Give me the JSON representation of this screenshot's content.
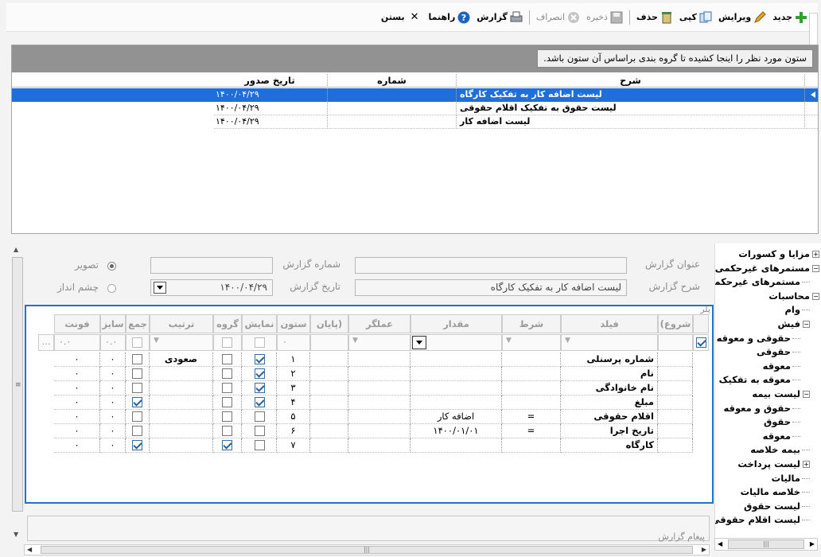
{
  "toolbar": {
    "items": [
      {
        "label": "جدید",
        "icon": "add-icon",
        "enabled": true
      },
      {
        "label": "ویرایش",
        "icon": "pencil-icon",
        "enabled": true
      },
      {
        "label": "کپی",
        "icon": "copy-icon",
        "enabled": true
      },
      {
        "label": "حذف",
        "icon": "delete-icon",
        "enabled": true
      },
      {
        "label": "ذخیره",
        "icon": "save-icon",
        "enabled": false
      },
      {
        "label": "انصراف",
        "icon": "cancel-icon",
        "enabled": false
      },
      {
        "label": "گزارش",
        "icon": "print-icon",
        "enabled": true
      },
      {
        "label": "راهنما",
        "icon": "help-icon",
        "enabled": true
      },
      {
        "label": "بستن",
        "icon": "close-icon",
        "enabled": true
      }
    ]
  },
  "report_grid": {
    "group_hint": "ستون مورد نظر را اینجا کشیده تا گروه بندی براساس آن ستون باشد.",
    "headers": {
      "desc": "شرح",
      "number": "شماره",
      "date": "تاریخ صدور"
    },
    "rows": [
      {
        "desc": "لیست اضافه کار به تفکیک کارگاه",
        "number": "",
        "date": "۱۴۰۰/۰۴/۲۹",
        "selected": true
      },
      {
        "desc": "لیست حقوق به تفکیک اقلام حقوقی",
        "number": "",
        "date": "۱۴۰۰/۰۴/۲۹",
        "selected": false
      },
      {
        "desc": "لیست اضافه کار",
        "number": "",
        "date": "۱۴۰۰/۰۴/۲۹",
        "selected": false
      }
    ]
  },
  "form": {
    "title_label": "عنوان گزارش",
    "title_value": "",
    "desc_label": "شرح گزارش",
    "desc_value": "لیست اضافه کار به تفکیک کارگاه",
    "number_label": "شماره گزارش",
    "number_value": "",
    "date_label": "تاریخ گزارش",
    "date_value": "۱۴۰۰/۰۴/۲۹",
    "opt_image": "تصویر",
    "opt_landscape": "چشم انداز",
    "msg_label": "پیغام گزارش"
  },
  "detail": {
    "side_label": "پلر",
    "headers": {
      "start": "(شروع",
      "field": "فیلد",
      "cond": "شرط",
      "value": "مقدار",
      "op": "عملگر",
      "end": "پایان)",
      "col": "ستون",
      "show": "نمایش",
      "group": "گروه",
      "order": "ترتیب",
      "sum": "جمع",
      "size": "سایز",
      "font": "فونت"
    },
    "filters": {
      "col": "۰",
      "size": "۰.۰",
      "font": "۰.۰"
    },
    "rows": [
      {
        "field": "شماره پرسنلی",
        "cond": "",
        "value": "",
        "col": "۱",
        "show": true,
        "group": false,
        "order": "صعودی",
        "sum": false,
        "size": "۰",
        "font": "۰"
      },
      {
        "field": "نام",
        "cond": "",
        "value": "",
        "col": "۲",
        "show": true,
        "group": false,
        "order": "",
        "sum": false,
        "size": "۰",
        "font": "۰"
      },
      {
        "field": "نام خانوادگی",
        "cond": "",
        "value": "",
        "col": "۳",
        "show": true,
        "group": false,
        "order": "",
        "sum": false,
        "size": "۰",
        "font": "۰"
      },
      {
        "field": "مبلغ",
        "cond": "",
        "value": "",
        "col": "۴",
        "show": true,
        "group": false,
        "order": "",
        "sum": true,
        "size": "۰",
        "font": "۰"
      },
      {
        "field": "اقلام حقوقی",
        "cond": "=",
        "value": "اضافه کار",
        "col": "۵",
        "show": false,
        "group": false,
        "order": "",
        "sum": false,
        "size": "۰",
        "font": "۰"
      },
      {
        "field": "تاریخ اجرا",
        "cond": "=",
        "value": "۱۴۰۰/۰۱/۰۱",
        "col": "۶",
        "show": false,
        "group": false,
        "order": "",
        "sum": false,
        "size": "۰",
        "font": "۰"
      },
      {
        "field": "کارگاه",
        "cond": "",
        "value": "",
        "col": "۷",
        "show": false,
        "group": true,
        "order": "",
        "sum": true,
        "size": "۰",
        "font": "۰"
      }
    ]
  },
  "tree": {
    "items": [
      {
        "label": "مزایا و کسورات",
        "level": 0,
        "toggle": "+"
      },
      {
        "label": "مستمرهای غیرحکمی",
        "level": 0,
        "toggle": "-"
      },
      {
        "label": "مستمرهای غیرحکمی",
        "level": 1,
        "toggle": ""
      },
      {
        "label": "محاسبات",
        "level": 0,
        "toggle": "-"
      },
      {
        "label": "وام",
        "level": 1,
        "toggle": ""
      },
      {
        "label": "فیش",
        "level": 1,
        "toggle": "-"
      },
      {
        "label": "حقوقی و معوقه",
        "level": 2,
        "toggle": ""
      },
      {
        "label": "حقوقی",
        "level": 2,
        "toggle": ""
      },
      {
        "label": "معوقه",
        "level": 2,
        "toggle": ""
      },
      {
        "label": "معوقه به تفکیک",
        "level": 2,
        "toggle": ""
      },
      {
        "label": "لیست بیمه",
        "level": 1,
        "toggle": "-"
      },
      {
        "label": "حقوق و معوقه",
        "level": 2,
        "toggle": ""
      },
      {
        "label": "حقوق",
        "level": 2,
        "toggle": ""
      },
      {
        "label": "معوقه",
        "level": 2,
        "toggle": ""
      },
      {
        "label": "بیمه خلاصه",
        "level": 1,
        "toggle": ""
      },
      {
        "label": "لیست پرداخت",
        "level": 1,
        "toggle": "+"
      },
      {
        "label": "مالیات",
        "level": 1,
        "toggle": ""
      },
      {
        "label": "خلاصه مالیات",
        "level": 1,
        "toggle": ""
      },
      {
        "label": "لیست حقوق",
        "level": 1,
        "toggle": ""
      },
      {
        "label": "لیست اقلام حقوقی",
        "level": 1,
        "toggle": "check"
      }
    ]
  },
  "colors": {
    "accent": "#1d74c9",
    "selection": "#1e6fd9",
    "group_panel": "#929292"
  }
}
